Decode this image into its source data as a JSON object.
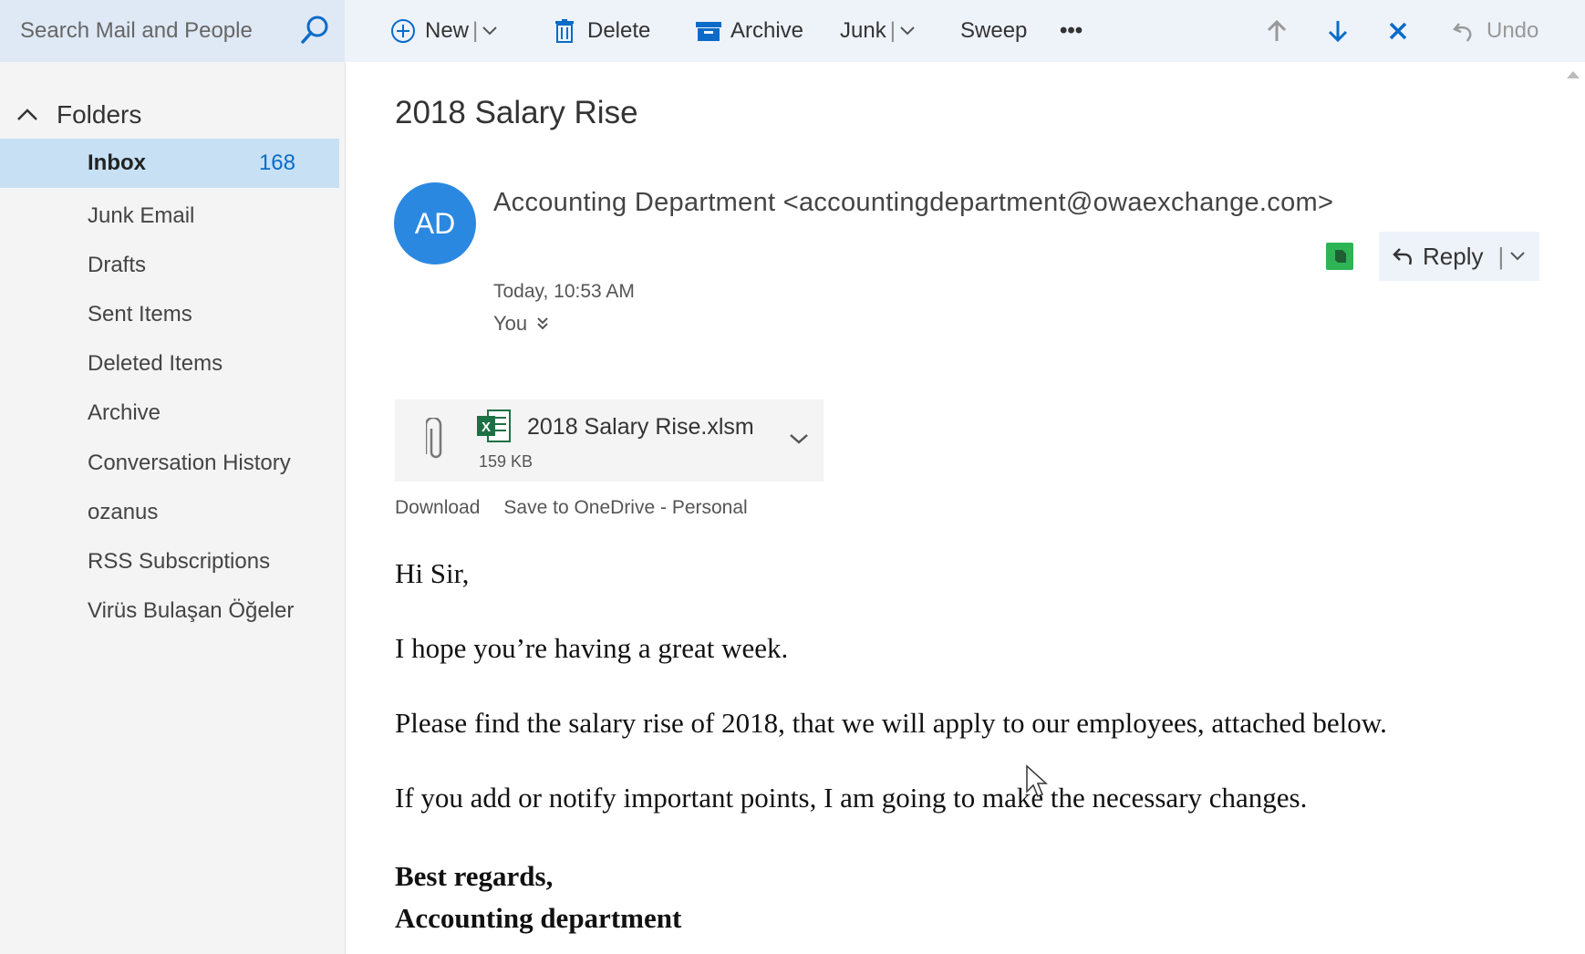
{
  "search": {
    "placeholder": "Search Mail and People"
  },
  "toolbar": {
    "new_label": "New",
    "delete_label": "Delete",
    "archive_label": "Archive",
    "junk_label": "Junk",
    "sweep_label": "Sweep",
    "more_label": "•••",
    "undo_label": "Undo"
  },
  "sidebar": {
    "header": "Folders",
    "folders": [
      {
        "label": "Inbox",
        "count": "168"
      },
      {
        "label": "Junk Email"
      },
      {
        "label": "Drafts"
      },
      {
        "label": "Sent Items"
      },
      {
        "label": "Deleted Items"
      },
      {
        "label": "Archive"
      },
      {
        "label": "Conversation History"
      },
      {
        "label": "ozanus"
      },
      {
        "label": "RSS Subscriptions"
      },
      {
        "label": "Virüs Bulaşan Öğeler"
      }
    ]
  },
  "message": {
    "subject": "2018 Salary Rise",
    "avatar_initials": "AD",
    "sender": "Accounting Department <accountingdepartment@owaexchange.com>",
    "reply_label": "Reply",
    "timestamp": "Today, 10:53 AM",
    "recipient": "You",
    "attachment": {
      "name": "2018 Salary Rise.xlsm",
      "size": "159 KB",
      "download_label": "Download",
      "save_label": "Save to OneDrive - Personal"
    },
    "body": {
      "greeting": "Hi Sir,",
      "line1": "I hope you’re having a great week.",
      "line2": "Please find the salary rise of 2018, that we will apply to our employees, attached below.",
      "line3": "If you add or notify important points, I am going to make the necessary changes.",
      "signoff": "Best regards,",
      "signature": "Accounting department"
    }
  },
  "colors": {
    "accent": "#0b6bc9",
    "avatar": "#2b88e0",
    "selected": "#c7e0f4",
    "toolbar_bg": "#eef3fa"
  }
}
